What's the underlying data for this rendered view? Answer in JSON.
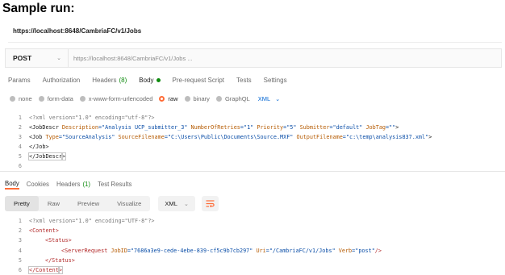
{
  "heading": "Sample run:",
  "top_url": "https://localhost:8648/CambriaFC/v1/Jobs",
  "request": {
    "method": "POST",
    "url": "https://localhost:8648/CambriaFC/v1/Jobs ..."
  },
  "request_tabs": [
    {
      "label": "Params"
    },
    {
      "label": "Authorization"
    },
    {
      "label": "Headers",
      "badge": "(8)"
    },
    {
      "label": "Body",
      "active": true
    },
    {
      "label": "Pre-request Script"
    },
    {
      "label": "Tests"
    },
    {
      "label": "Settings"
    }
  ],
  "body_options": {
    "none": "none",
    "form_data": "form-data",
    "urlencoded": "x-www-form-urlencoded",
    "raw": "raw",
    "binary": "binary",
    "graphql": "GraphQL",
    "format": "XML",
    "selected": "raw"
  },
  "request_body": {
    "line_numbers": [
      "1",
      "2",
      "3",
      "4",
      "5",
      "6"
    ],
    "l1_a": "<?xml version=\"1.0\" encoding=\"utf-8\"?>",
    "l2_open": "<JobDescr ",
    "l2_a1": "Description",
    "l2_v1": "=\"Analysis UCP_submitter_3\" ",
    "l2_a2": "NumberOfRetries",
    "l2_v2": "=\"1\" ",
    "l2_a3": "Priority",
    "l2_v3": "=\"5\" ",
    "l2_a4": "Submitter",
    "l2_v4": "=\"default\" ",
    "l2_a5": "JobTag",
    "l2_v5": "=\"\"",
    "l2_close": ">",
    "l3_open": "<Job ",
    "l3_a1": "Type",
    "l3_v1": "=\"SourceAnalysis\" ",
    "l3_a2": "SourceFilename",
    "l3_v2": "=\"C:\\Users\\Public\\Documents\\Source.MXF\" ",
    "l3_a3": "OutputFilename",
    "l3_v3": "=\"c:\\temp\\analysis837.xml\"",
    "l3_close": ">",
    "l4": "</Job>",
    "l5_open": "</JobDescr",
    "l5_close": ">"
  },
  "response_tabs": [
    {
      "label": "Body",
      "active": true
    },
    {
      "label": "Cookies"
    },
    {
      "label": "Headers",
      "count": "(1)"
    },
    {
      "label": "Test Results"
    }
  ],
  "response_toolbar": {
    "pretty": "Pretty",
    "raw": "Raw",
    "preview": "Preview",
    "visualize": "Visualize",
    "format": "XML"
  },
  "response_body": {
    "line_numbers": [
      "1",
      "2",
      "3",
      "4",
      "5",
      "6"
    ],
    "l1": "<?xml version=\"1.0\" encoding=\"UTF-8\"?>",
    "l2": "<Content>",
    "l3": "<Status>",
    "l4_open": "<ServerRequest ",
    "l4_a1": "JobID",
    "l4_v1": "=\"7686a3e9-cede-4ebe-839-cf5c9b7cb297\" ",
    "l4_a2": "Uri",
    "l4_v2": "=\"/CambriaFC/v1/Jobs\" ",
    "l4_a3": "Verb",
    "l4_v3": "=\"post\"",
    "l4_close": "/>",
    "l5": "</Status>",
    "l6_open": "</Content",
    "l6_close": ">"
  },
  "colors": {
    "accent": "#ff6c37",
    "green": "#0f8b0f",
    "link_blue": "#0265d2",
    "attr": "#b55a00",
    "value": "#0c4fa8"
  }
}
